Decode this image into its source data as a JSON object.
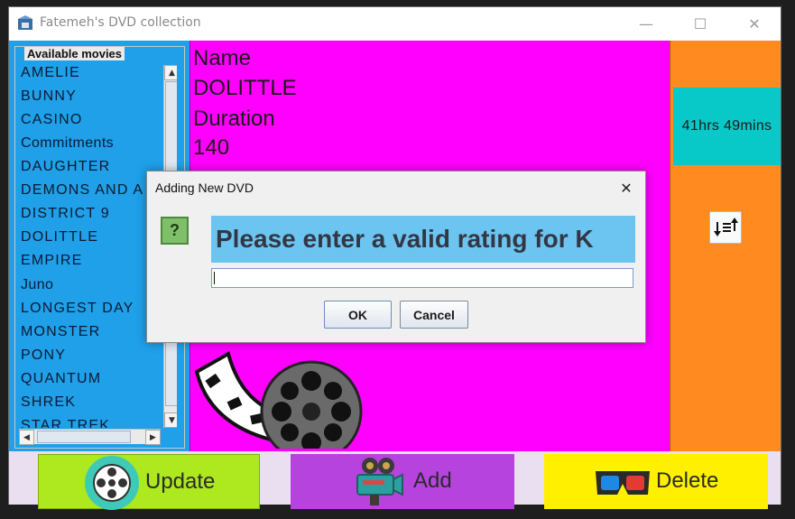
{
  "window": {
    "title": "Fatemeh's DVD collection"
  },
  "movie_list": {
    "legend": "Available movies",
    "items": [
      "AMELIE",
      "BUNNY",
      "CASINO",
      "Commitments",
      "DAUGHTER",
      "DEMONS AND A",
      "DISTRICT 9",
      "DOLITTLE",
      "EMPIRE",
      "Juno",
      "LONGEST DAY",
      "MONSTER",
      "PONY",
      "QUANTUM",
      "SHREK",
      "STAR TREK"
    ]
  },
  "details": {
    "name_label": "Name",
    "name_value": "DOLITTLE",
    "duration_label": "Duration",
    "duration_value": "140"
  },
  "summary": {
    "total_duration": "41hrs 49mins"
  },
  "buttons": {
    "update": "Update",
    "add": "Add",
    "delete": "Delete"
  },
  "dialog": {
    "title": "Adding New DVD",
    "message": "Please enter a valid rating for K",
    "input_value": "",
    "ok_label": "OK",
    "cancel_label": "Cancel"
  },
  "colors": {
    "list_bg": "#1fa0e8",
    "details_bg": "#ff00ff",
    "summary_panel": "#ff8a1f",
    "summary_box": "#08c8c8",
    "update_btn": "#aee81e",
    "add_btn": "#b643de",
    "delete_btn": "#fff000",
    "prompt_bg": "#6cc5f0"
  },
  "icons": {
    "app": "dvd-app-icon",
    "sort": "sort-icon",
    "update": "film-reel-icon",
    "add": "movie-camera-icon",
    "delete": "3d-glasses-icon",
    "question": "question-icon"
  }
}
